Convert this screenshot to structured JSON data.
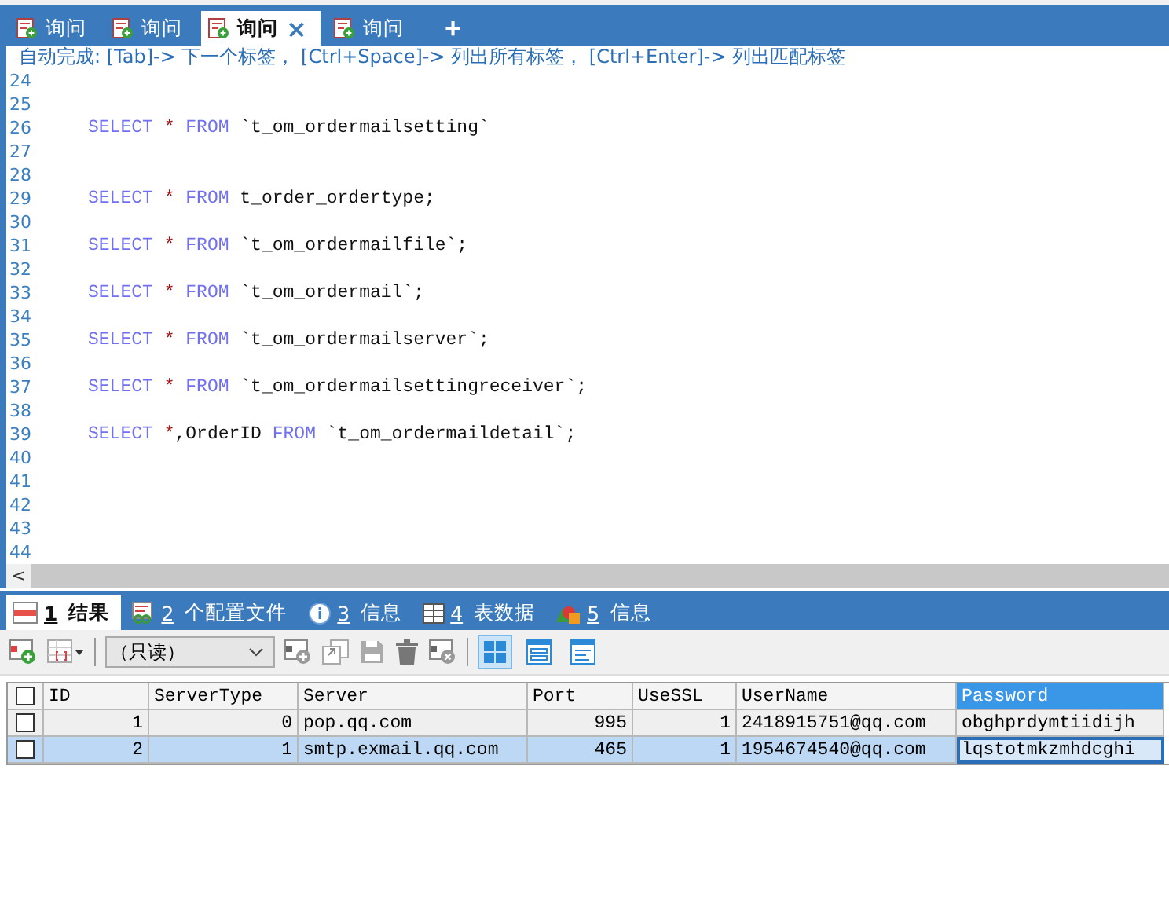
{
  "query_tabs": [
    {
      "label": "询问",
      "selected": false
    },
    {
      "label": "询问",
      "selected": false
    },
    {
      "label": "询问",
      "selected": true,
      "close": "×"
    },
    {
      "label": "询问",
      "selected": false
    }
  ],
  "add_tab": "+",
  "autocomplete_hint": "自动完成: [Tab]-> 下一个标签， [Ctrl+Space]-> 列出所有标签， [Ctrl+Enter]-> 列出匹配标签",
  "editor_lines": [
    {
      "number": "24"
    },
    {
      "number": "25"
    },
    {
      "number": "26",
      "segments": [
        {
          "kind": "keyword",
          "text": "SELECT"
        },
        {
          "kind": "star",
          "text": "*"
        },
        {
          "kind": "keyword",
          "text": "FROM"
        },
        {
          "kind": "ident",
          "text": "`t_om_ordermailsetting`"
        }
      ]
    },
    {
      "number": "27"
    },
    {
      "number": "28"
    },
    {
      "number": "29",
      "segments": [
        {
          "kind": "keyword",
          "text": "SELECT"
        },
        {
          "kind": "star",
          "text": "*"
        },
        {
          "kind": "keyword",
          "text": "FROM"
        },
        {
          "kind": "ident",
          "text": "t_order_ordertype;"
        }
      ]
    },
    {
      "number": "30"
    },
    {
      "number": "31",
      "segments": [
        {
          "kind": "keyword",
          "text": "SELECT"
        },
        {
          "kind": "star",
          "text": "*"
        },
        {
          "kind": "keyword",
          "text": "FROM"
        },
        {
          "kind": "ident",
          "text": "`t_om_ordermailfile`;"
        }
      ]
    },
    {
      "number": "32"
    },
    {
      "number": "33",
      "segments": [
        {
          "kind": "keyword",
          "text": "SELECT"
        },
        {
          "kind": "star",
          "text": "*"
        },
        {
          "kind": "keyword",
          "text": "FROM"
        },
        {
          "kind": "ident",
          "text": "`t_om_ordermail`;"
        }
      ]
    },
    {
      "number": "34"
    },
    {
      "number": "35",
      "segments": [
        {
          "kind": "keyword",
          "text": "SELECT"
        },
        {
          "kind": "star",
          "text": "*"
        },
        {
          "kind": "keyword",
          "text": "FROM"
        },
        {
          "kind": "ident",
          "text": "`t_om_ordermailserver`;"
        }
      ]
    },
    {
      "number": "36"
    },
    {
      "number": "37",
      "segments": [
        {
          "kind": "keyword",
          "text": "SELECT"
        },
        {
          "kind": "star",
          "text": "*"
        },
        {
          "kind": "keyword",
          "text": "FROM"
        },
        {
          "kind": "ident",
          "text": "`t_om_ordermailsettingreceiver`;"
        }
      ]
    },
    {
      "number": "38"
    },
    {
      "number": "39",
      "segments": [
        {
          "kind": "keyword",
          "text": "SELECT"
        },
        {
          "kind": "star",
          "text": "*"
        },
        {
          "kind": "ident",
          "text": ",OrderID",
          "joined": true
        },
        {
          "kind": "keyword",
          "text": "FROM"
        },
        {
          "kind": "ident",
          "text": "`t_om_ordermaildetail`;"
        }
      ]
    },
    {
      "number": "40"
    },
    {
      "number": "41"
    },
    {
      "number": "42"
    },
    {
      "number": "43"
    },
    {
      "number": "44"
    }
  ],
  "scroll_left": "<",
  "result_tabs": [
    {
      "key": "1",
      "label": "结果",
      "kind": "result",
      "selected": true
    },
    {
      "key": "2",
      "label": "个配置文件",
      "kind": "profile",
      "selected": false
    },
    {
      "key": "3",
      "label": "信息",
      "kind": "info",
      "selected": false
    },
    {
      "key": "4",
      "label": "表数据",
      "kind": "table",
      "selected": false
    },
    {
      "key": "5",
      "label": "信息",
      "kind": "shapes",
      "selected": false
    }
  ],
  "toolbar": {
    "mode_select": "（只读）",
    "views": [
      {
        "kind": "grid",
        "selected": true
      },
      {
        "kind": "form",
        "selected": false
      },
      {
        "kind": "text",
        "selected": false
      }
    ]
  },
  "table": {
    "select_all_checked": false,
    "columns": [
      {
        "label": "ID",
        "kind": "number",
        "selected": false
      },
      {
        "label": "ServerType",
        "kind": "number",
        "selected": false
      },
      {
        "label": "Server",
        "kind": "text",
        "selected": false
      },
      {
        "label": "Port",
        "kind": "number",
        "selected": false
      },
      {
        "label": "UseSSL",
        "kind": "number",
        "selected": false
      },
      {
        "label": "UserName",
        "kind": "text",
        "selected": false
      },
      {
        "label": "Password",
        "kind": "text",
        "selected": true
      }
    ],
    "rows": [
      {
        "checked": false,
        "selected": false,
        "cells": [
          "1",
          "0",
          "pop.qq.com",
          "995",
          "1",
          "2418915751@qq.com",
          "obghprdymtiidijh"
        ]
      },
      {
        "checked": false,
        "selected": true,
        "cells": [
          "2",
          "1",
          "smtp.exmail.qq.com",
          "465",
          "1",
          "1954674540@qq.com",
          "lqstotmkzmhdcghi"
        ]
      }
    ]
  }
}
